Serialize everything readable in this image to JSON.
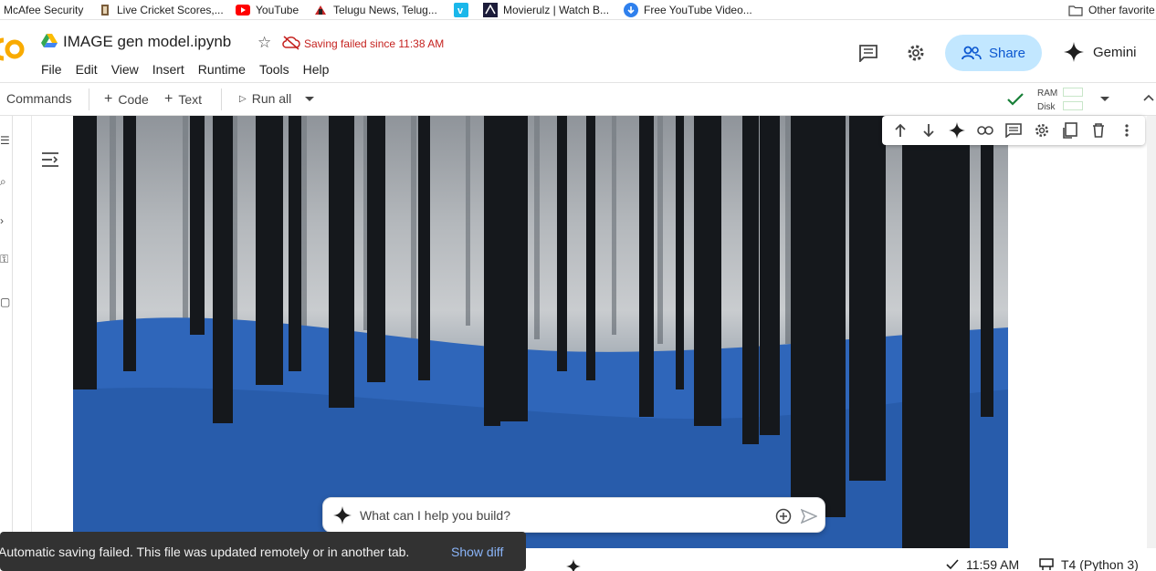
{
  "bookmarks": [
    {
      "label": "McAfee Security",
      "icon": "none"
    },
    {
      "label": "Live Cricket Scores,...",
      "icon": "cricket-icon"
    },
    {
      "label": "YouTube",
      "icon": "youtube-icon"
    },
    {
      "label": "Telugu News, Telug...",
      "icon": "news-icon"
    },
    {
      "label": "",
      "icon": "vimeo-icon"
    },
    {
      "label": "Movierulz | Watch B...",
      "icon": "movie-icon"
    },
    {
      "label": "Free YouTube Video...",
      "icon": "download-icon"
    },
    {
      "label": "Other favorite",
      "icon": "folder-icon"
    }
  ],
  "header": {
    "title": "IMAGE gen model.ipynb",
    "save_status": "Saving failed since 11:38 AM",
    "menu": [
      "File",
      "Edit",
      "View",
      "Insert",
      "Runtime",
      "Tools",
      "Help"
    ],
    "share_label": "Share",
    "gemini_label": "Gemini"
  },
  "toolbar": {
    "commands_label": "Commands",
    "code_label": "Code",
    "text_label": "Text",
    "run_all_label": "Run all",
    "ram_label": "RAM",
    "disk_label": "Disk"
  },
  "prompt": {
    "placeholder": "What can I help you build?"
  },
  "snackbar": {
    "message": "Automatic saving failed. This file was updated remotely or in another tab.",
    "action": "Show diff"
  },
  "status": {
    "time": "11:59 AM",
    "runtime": "T4 (Python 3)"
  },
  "colors": {
    "accent": "#0b57d0",
    "share_bg": "#c2e7ff",
    "error": "#c5221f",
    "ok": "#188038",
    "forest_floor": "#2d64b8"
  }
}
